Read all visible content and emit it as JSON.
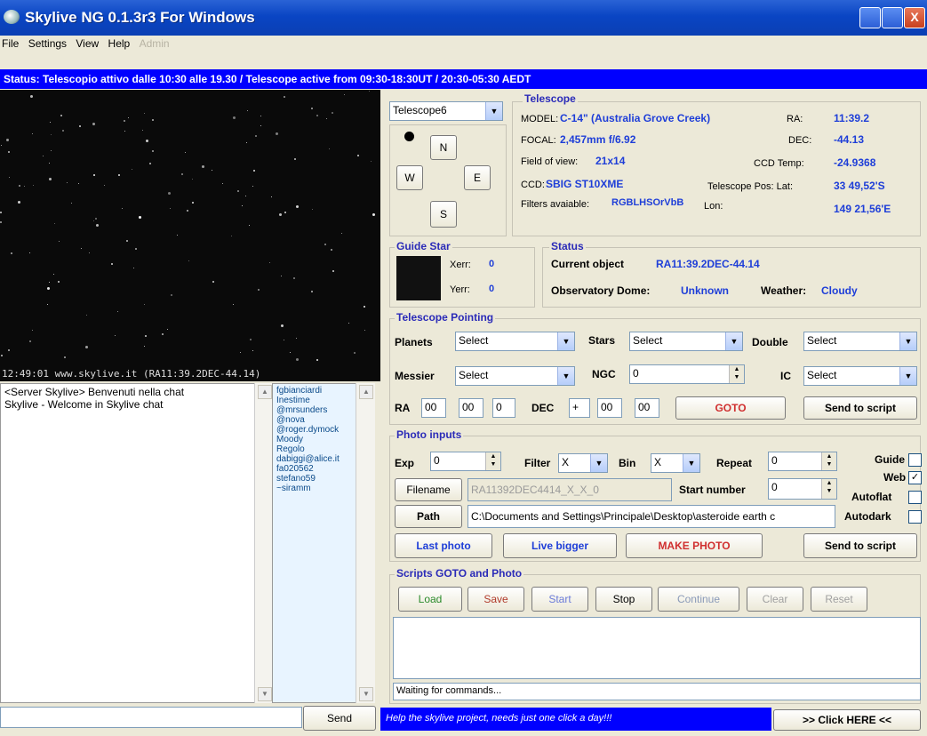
{
  "window": {
    "title": "Skylive NG 0.1.3r3 For Windows",
    "close_glyph": "X"
  },
  "menu": {
    "items": [
      "File",
      "Settings",
      "View",
      "Help",
      "Admin"
    ]
  },
  "status_banner": "Status: Telescopio attivo dalle 10:30 alle 19.30 / Telescope active from 09:30-18:30UT / 20:30-05:30 AEDT",
  "image": {
    "caption": "12:49:01 www.skylive.it (RA11:39.2DEC-44.14)"
  },
  "chat": {
    "messages": [
      "<Server Skylive> Benvenuti nella chat",
      "Skylive - Welcome in Skylive chat"
    ],
    "users": [
      "fgbianciardi",
      "Inestime",
      "@mrsunders",
      "@nova",
      "@roger.dymock",
      "Moody",
      "Regolo",
      "dabiggi@alice.it",
      "fa020562",
      "stefano59",
      "~siramm"
    ],
    "send_label": "Send"
  },
  "telescope": {
    "selector": "Telescope6",
    "nav": {
      "n": "N",
      "w": "W",
      "e": "E",
      "s": "S"
    },
    "legend": "Telescope",
    "model_label": "MODEL:",
    "model": "C-14\" (Australia Grove Creek)",
    "focal_label": "FOCAL:",
    "focal": "2,457mm f/6.92",
    "fov_label": "Field of view:",
    "fov": "21x14",
    "ccd_label": "CCD:",
    "ccd": "SBIG ST10XME",
    "filters_label": "Filters avaiable:",
    "filters": "RGBLHSOrVbB",
    "ra_label": "RA:",
    "ra": "11:39.2",
    "dec_label": "DEC:",
    "dec": "-44.13",
    "ccdtemp_label": "CCD Temp:",
    "ccdtemp": "-24.9368",
    "pos_label": "Telescope Pos: Lat:",
    "lat": "33 49,52'S",
    "lon_label": "Lon:",
    "lon": "149 21,56'E"
  },
  "guide": {
    "legend": "Guide Star",
    "xerr_label": "Xerr:",
    "xerr": "0",
    "yerr_label": "Yerr:",
    "yerr": "0"
  },
  "status": {
    "legend": "Status",
    "current_label": "Current object",
    "current": "RA11:39.2DEC-44.14",
    "dome_label": "Observatory Dome:",
    "dome": "Unknown",
    "weather_label": "Weather:",
    "weather": "Cloudy"
  },
  "pointing": {
    "legend": "Telescope Pointing",
    "planets_label": "Planets",
    "planets": "Select",
    "stars_label": "Stars",
    "stars": "Select",
    "double_label": "Double",
    "double": "Select",
    "messier_label": "Messier",
    "messier": "Select",
    "ngc_label": "NGC",
    "ngc": "0",
    "ic_label": "IC",
    "ic": "Select",
    "ra_label": "RA",
    "ra_h": "00",
    "ra_m": "00",
    "ra_s": "0",
    "dec_label": "DEC",
    "dec_sign": "+",
    "dec_d": "00",
    "dec_m": "00",
    "goto": "GOTO",
    "send": "Send to script"
  },
  "photo": {
    "legend": "Photo inputs",
    "exp_label": "Exp",
    "exp": "0",
    "filter_label": "Filter",
    "filter": "X",
    "bin_label": "Bin",
    "bin": "X",
    "repeat_label": "Repeat",
    "repeat": "0",
    "guide_label": "Guide",
    "web_label": "Web",
    "autoflat_label": "Autoflat",
    "autodark_label": "Autodark",
    "web_check": "✓",
    "filename_btn": "Filename",
    "filename": "RA11392DEC4414_X_X_0",
    "startnum_label": "Start number",
    "startnum": "0",
    "path_btn": "Path",
    "path": "C:\\Documents and Settings\\Principale\\Desktop\\asteroide earth c",
    "last_photo": "Last photo",
    "live_bigger": "Live bigger",
    "make_photo": "MAKE PHOTO",
    "send": "Send to script"
  },
  "scripts": {
    "legend": "Scripts GOTO and Photo",
    "buttons": [
      "Load",
      "Save",
      "Start",
      "Stop",
      "Continue",
      "Clear",
      "Reset"
    ],
    "status": "Waiting for commands..."
  },
  "footer": {
    "promo": "Help the skylive project, needs just one click a day!!!",
    "click": ">> Click HERE <<"
  },
  "colors": {
    "accent_blue": "#1e3ed8",
    "banner": "#0000ff",
    "goto_red": "#d03030",
    "load_green": "#2a8a2a"
  }
}
